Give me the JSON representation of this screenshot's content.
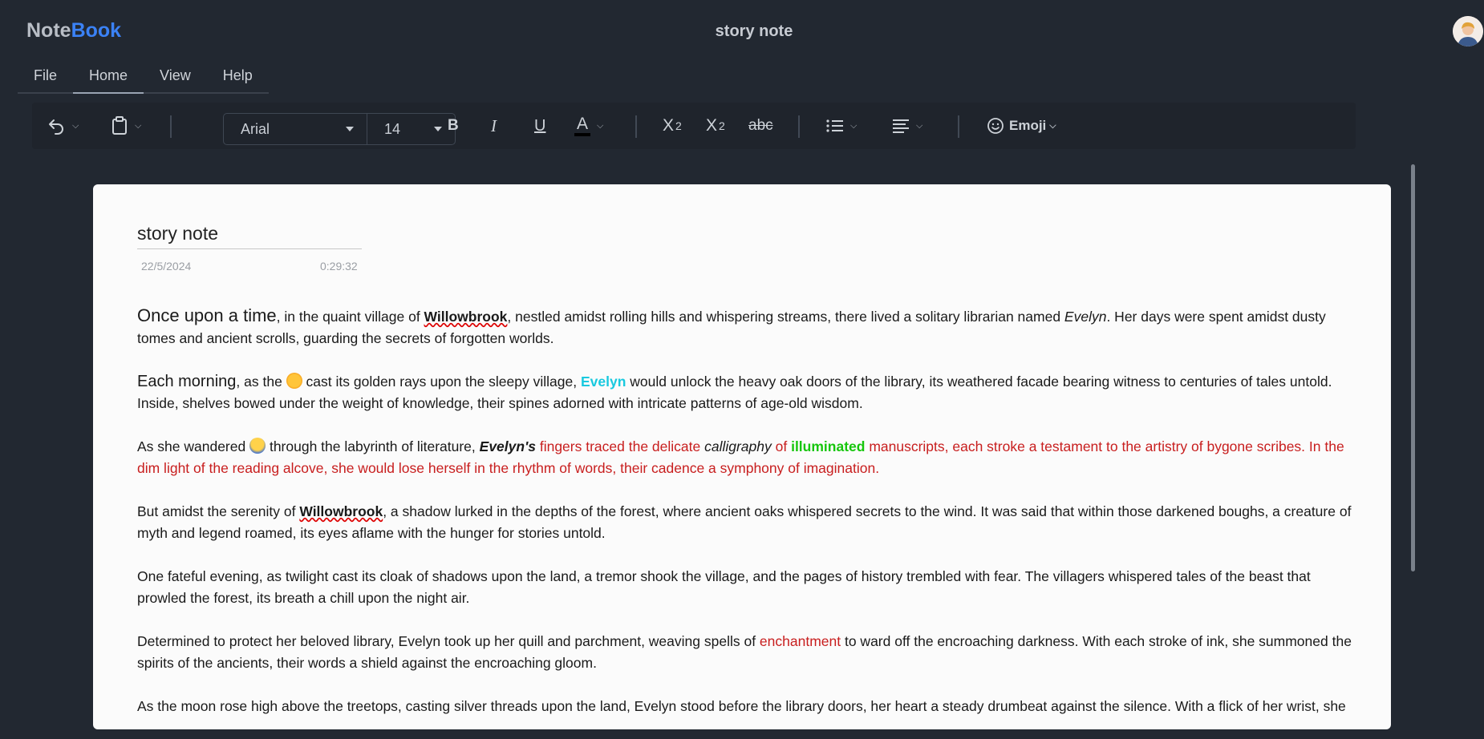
{
  "app": {
    "brand_part1": "Note",
    "brand_part2": "Book",
    "title": "story note"
  },
  "menu": [
    "File",
    "Home",
    "View",
    "Help"
  ],
  "toolbar": {
    "font": "Arial",
    "size": "14",
    "bold": "B",
    "italic": "I",
    "underline": "U",
    "color": "A",
    "sub": "X",
    "sub_idx": "2",
    "sup": "X",
    "sup_idx": "2",
    "strike": "abc",
    "emoji": "Emoji"
  },
  "note": {
    "title": "story note",
    "date": "22/5/2024",
    "time": "0:29:32",
    "p1": {
      "lead": "Once upon a time",
      "t1": ", in the quaint village of ",
      "willow": "Willowbrook",
      "t2": ", nestled amidst rolling hills and whispering streams, there lived a solitary librarian named ",
      "evelyn": "Evelyn",
      "t3": ". Her days were spent amidst dusty tomes and ancient scrolls, guarding the secrets of forgotten worlds."
    },
    "p2": {
      "lead": "Each morning",
      "t1": ", as the ",
      "t2": " cast its golden rays upon the sleepy village, ",
      "evelyn": "Evelyn",
      "t3": " would unlock the heavy oak doors of the library, its weathered facade bearing witness to centuries of tales untold. Inside, shelves bowed under the weight of knowledge, their spines adorned with intricate patterns of age-old wisdom."
    },
    "p3": {
      "t1": "As she wandered ",
      "t2": " through the labyrinth of literature, ",
      "evelyns": "Evelyn's",
      "r1": " fingers traced the delicate ",
      "calligraphy": "calligraphy",
      "r2": " of ",
      "illuminated": "illuminated",
      "r3": " manuscripts, each stroke a testament to the artistry of bygone scribes. In the dim light of the reading alcove, she would lose herself in the rhythm of words, their cadence a symphony of imagination."
    },
    "p4": {
      "t1": "But amidst the serenity of ",
      "willow": "Willowbrook",
      "t2": ", a shadow lurked in the depths of the forest, where ancient oaks whispered secrets to the wind. It was said that within those darkened boughs, a creature of myth and legend roamed, its eyes aflame with the hunger for stories untold."
    },
    "p5": "One fateful evening, as twilight cast its cloak of shadows upon the land, a tremor shook the village, and the pages of history trembled with fear. The villagers whispered tales of the beast that prowled the forest, its breath a chill upon the night air.",
    "p6": {
      "t1": "Determined to protect her beloved library, Evelyn took up her quill and parchment, weaving spells of ",
      "ench": "enchantment",
      "t2": " to ward off the encroaching darkness. With each stroke of ink, she summoned the spirits of the ancients, their words a shield against the encroaching gloom."
    },
    "p7": "As the moon rose high above the treetops, casting silver threads upon the land, Evelyn stood before the library doors, her heart a steady drumbeat against the silence. With a flick of her wrist, she"
  }
}
